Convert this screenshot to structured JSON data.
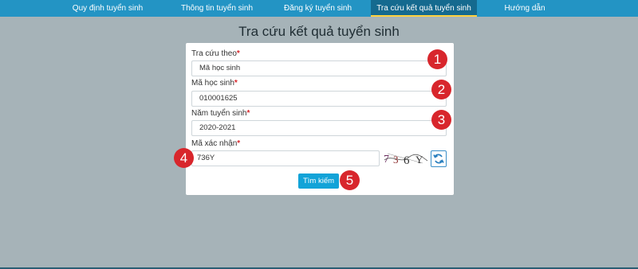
{
  "nav": {
    "items": [
      {
        "label": "Quy định tuyển sinh"
      },
      {
        "label": "Thông tin tuyển sinh"
      },
      {
        "label": "Đăng ký tuyển sinh"
      },
      {
        "label": "Tra cứu kết quả tuyển sinh"
      },
      {
        "label": "Hướng dẫn"
      }
    ],
    "active_index": 3
  },
  "page_title": "Tra cứu kết quả tuyển sinh",
  "form": {
    "lookup_by": {
      "label": "Tra cứu theo",
      "value": "Mã học sinh"
    },
    "student_id": {
      "label": "Mã học sinh",
      "value": "010001625"
    },
    "year": {
      "label": "Năm tuyển sinh",
      "value": "2020-2021"
    },
    "captcha": {
      "label": "Mã xác nhận",
      "value": "736Y",
      "image_text": "736Y"
    },
    "required_mark": "*",
    "search_button": "Tìm kiếm"
  },
  "markers": [
    "1",
    "2",
    "3",
    "4",
    "5"
  ],
  "colors": {
    "nav_bg": "#2394c4",
    "nav_active": "#156a8f",
    "page_bg": "#a6b3b8",
    "button": "#12a3d8",
    "marker": "#d8262c",
    "required": "#d9262b"
  }
}
